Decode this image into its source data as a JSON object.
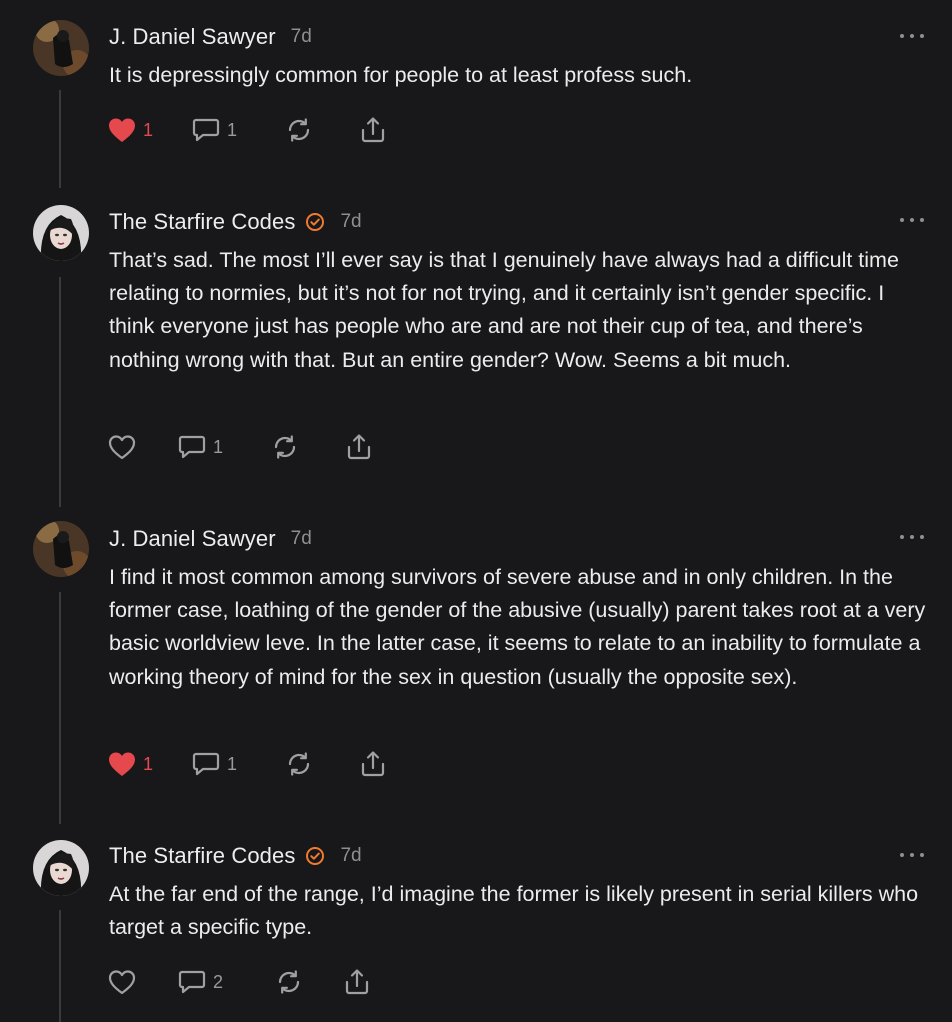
{
  "comments": [
    {
      "author": "J. Daniel Sawyer",
      "avatar": "dark-landscape-avatar",
      "verified": false,
      "time": "7d",
      "text": "It is depressingly common for people to at least profess such.",
      "likes": "1",
      "liked": true,
      "replies": "1"
    },
    {
      "author": "The Starfire Codes",
      "avatar": "portrait-avatar",
      "verified": true,
      "time": "7d",
      "text": "That’s sad. The most I’ll ever say is that I genuinely have always had a difficult time relating to normies, but it’s not for not trying, and it certainly isn’t gender specific. I think everyone just has people who are and are not their cup of tea, and there’s nothing wrong with that. But an entire gender? Wow. Seems a bit much.",
      "likes": "",
      "liked": false,
      "replies": "1"
    },
    {
      "author": "J. Daniel Sawyer",
      "avatar": "dark-landscape-avatar",
      "verified": false,
      "time": "7d",
      "text": "I find it most common among survivors of severe abuse and in only children. In the former case, loathing of the gender of the abusive (usually) parent takes root at a very basic worldview leve. In the latter case, it seems to relate to an inability to formulate a working theory of mind for the sex in question (usually the opposite sex).",
      "likes": "1",
      "liked": true,
      "replies": "1"
    },
    {
      "author": "The Starfire Codes",
      "avatar": "portrait-avatar",
      "verified": true,
      "time": "7d",
      "text": "At the far end of the range, I’d imagine the former is likely present in serial killers who target a specific type.",
      "likes": "",
      "liked": false,
      "replies": "2"
    }
  ],
  "colors": {
    "background": "#18181a",
    "like_red": "#e5484d",
    "verified_orange": "#f07a30",
    "muted": "#8e8e93"
  }
}
